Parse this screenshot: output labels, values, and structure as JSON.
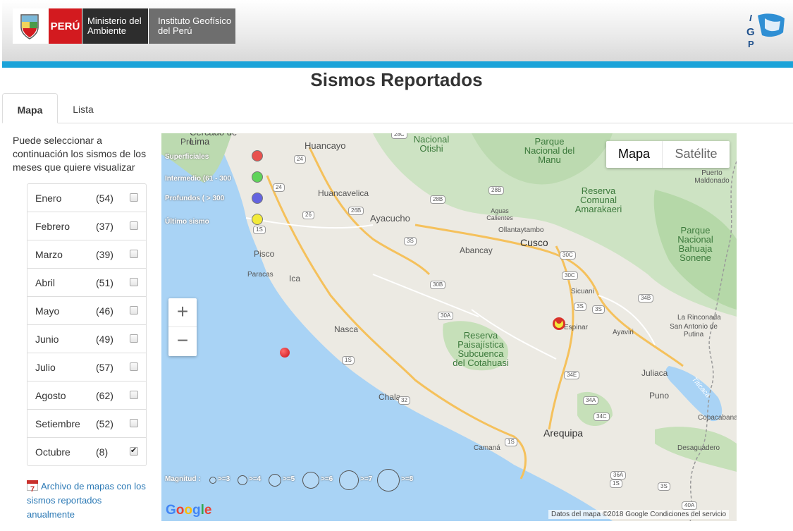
{
  "header": {
    "gov": {
      "peru": "PERÚ",
      "ministry": "Ministerio del Ambiente",
      "institute": "Instituto Geofísico del Perú"
    },
    "igp_logo": "IGP"
  },
  "page_title": "Sismos Reportados",
  "tabs": [
    {
      "label": "Mapa",
      "active": true
    },
    {
      "label": "Lista",
      "active": false
    }
  ],
  "sidebar": {
    "intro": "Puede seleccionar a continuación los sismos de los meses que quiere visualizar",
    "months": [
      {
        "name": "Enero",
        "count": "(54)",
        "checked": false
      },
      {
        "name": "Febrero",
        "count": "(37)",
        "checked": false
      },
      {
        "name": "Marzo",
        "count": "(39)",
        "checked": false
      },
      {
        "name": "Abril",
        "count": "(51)",
        "checked": false
      },
      {
        "name": "Mayo",
        "count": "(46)",
        "checked": false
      },
      {
        "name": "Junio",
        "count": "(49)",
        "checked": false
      },
      {
        "name": "Julio",
        "count": "(57)",
        "checked": false
      },
      {
        "name": "Agosto",
        "count": "(62)",
        "checked": false
      },
      {
        "name": "Setiembre",
        "count": "(52)",
        "checked": false
      },
      {
        "name": "Octubre",
        "count": "(8)",
        "checked": true
      }
    ],
    "archive_icon_day": "7",
    "archive_link": "Archivo de mapas con los sismos reportados anualmente"
  },
  "map": {
    "maptype": {
      "map": "Mapa",
      "satellite": "Satélite"
    },
    "zoom_in": "+",
    "zoom_out": "−",
    "legend": {
      "superficial": "Superficiales",
      "intermedio": "Intermedio (61 - 300",
      "profundos": "Profundos  ( > 300",
      "ultimo": "Último sismo",
      "magnitud": "Magnitud :",
      "mags": [
        ">=3",
        ">=4",
        ">=5",
        ">=6",
        ">=7",
        ">=8"
      ]
    },
    "legend_colors": {
      "superficial": "#e8524e",
      "intermedio": "#5fd35a",
      "profundos": "#6464e0",
      "ultimo": "#f2ea3a"
    },
    "places": {
      "lima": "Cercado de Lima",
      "pro": "Pro",
      "huancayo": "Huancayo",
      "huancavelica": "Huancavelica",
      "ayacucho": "Ayacucho",
      "pisco": "Pisco",
      "paracas": "Paracas",
      "ica": "Ica",
      "nasca": "Nasca",
      "chala": "Chala",
      "camana": "Camaná",
      "abancay": "Abancay",
      "cusco": "Cusco",
      "ollantaytambo": "Ollantaytambo",
      "aguas": "Aguas Calientes",
      "sicuani": "Sicuani",
      "espinar": "Espinar",
      "ayaviri": "Ayaviri",
      "arequipa": "Arequipa",
      "juliaca": "Juliaca",
      "puno": "Puno",
      "rinconada": "La Rinconada",
      "sanantonio": "San Antonio de Putina",
      "puerto": "Puerto Maldonado",
      "copacabana": "Copacabana",
      "desaguadero": "Desaguadero",
      "titicaca": "Titicaca"
    },
    "parks": {
      "otishi": "Nacional Otishi",
      "manu": "Parque Nacional del Manu",
      "amarakaeri": "Reserva Comunal Amarakaeri",
      "bahuaja": "Parque Nacional Bahuaja Sonene",
      "cotahuasi": "Reserva Paisajística Subcuenca del Cotahuasi"
    },
    "roads": [
      "28C",
      "24",
      "24",
      "26",
      "1S",
      "26B",
      "28B",
      "28B",
      "3S",
      "30C",
      "30C",
      "30B",
      "30A",
      "3S",
      "3S",
      "34B",
      "34E",
      "34A",
      "34C",
      "32",
      "1S",
      "1S",
      "36A",
      "3S",
      "40A",
      "1S"
    ],
    "google": "Google",
    "attribution": "Datos del mapa ©2018 Google   Condiciones del servicio"
  }
}
